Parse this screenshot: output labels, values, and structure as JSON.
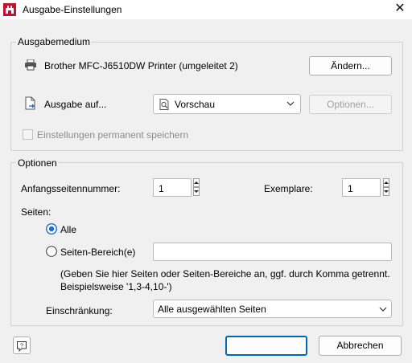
{
  "window": {
    "title": "Ausgabe-Einstellungen",
    "icons": {
      "app": "app-logo-icon",
      "close": "close-icon"
    }
  },
  "output_medium": {
    "group_label": "Ausgabemedium",
    "printer_name": "Brother MFC-J6510DW Printer (umgeleitet 2)",
    "change_button": "Ändern...",
    "output_to_label": "Ausgabe auf...",
    "output_to_value": "Vorschau",
    "options_button": "Optionen...",
    "save_permanent_label": "Einstellungen permanent speichern",
    "save_permanent_checked": false
  },
  "options": {
    "group_label": "Optionen",
    "start_page_label": "Anfangsseitennummer:",
    "start_page_value": "1",
    "copies_label": "Exemplare:",
    "copies_value": "1",
    "pages_label": "Seiten:",
    "all_label": "Alle",
    "range_label": "Seiten-Bereich(e)",
    "range_value": "",
    "selected": "all",
    "hint_line1": "(Geben Sie hier Seiten oder Seiten-Bereiche an, ggf. durch Komma getrennt.",
    "hint_line2": "Beispielsweise '1,3-4,10-')",
    "restriction_label": "Einschränkung:",
    "restriction_value": "Alle ausgewählten Seiten"
  },
  "footer": {
    "ok_label": "",
    "cancel_label": "Abbrechen"
  }
}
